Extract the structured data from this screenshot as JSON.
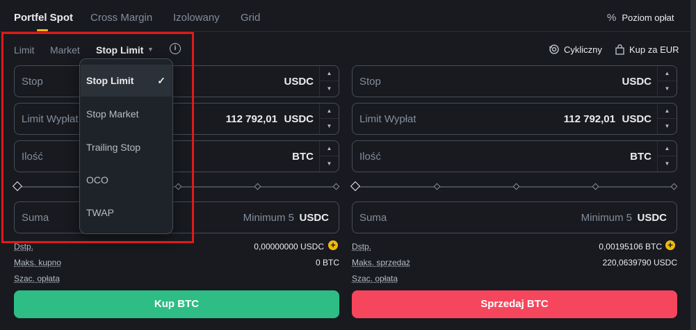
{
  "tabs": [
    {
      "label": "Portfel Spot"
    },
    {
      "label": "Cross Margin"
    },
    {
      "label": "Izolowany"
    },
    {
      "label": "Grid"
    }
  ],
  "fee_link": {
    "label": "Poziom opłat",
    "icon": "percent-icon"
  },
  "order_types": {
    "limit": "Limit",
    "market": "Market",
    "current": "Stop Limit"
  },
  "actions": {
    "recurring": "Cykliczny",
    "buy_eur": "Kup za EUR"
  },
  "buy_form": {
    "stop_label": "Stop",
    "stop_unit": "USDC",
    "limit_label": "Limit Wypłat",
    "limit_value": "112 792,01",
    "limit_unit": "USDC",
    "amount_label": "Ilość",
    "amount_unit": "BTC",
    "total_label": "Suma",
    "total_placeholder": "Minimum 5",
    "total_unit": "USDC",
    "avail_label": "Dstp.",
    "avail_value": "0,00000000 USDC",
    "max_label": "Maks. kupno",
    "max_value": "0 BTC",
    "fee_label": "Szac. opłata",
    "button": "Kup BTC"
  },
  "sell_form": {
    "stop_label": "Stop",
    "stop_unit": "USDC",
    "limit_label": "Limit Wypłat",
    "limit_value": "112 792,01",
    "limit_unit": "USDC",
    "amount_label": "Ilość",
    "amount_unit": "BTC",
    "total_label": "Suma",
    "total_placeholder": "Minimum 5",
    "total_unit": "USDC",
    "avail_label": "Dstp.",
    "avail_value": "0,00195106 BTC",
    "max_label": "Maks. sprzedaż",
    "max_value": "220,0639790 USDC",
    "fee_label": "Szac. opłata",
    "button": "Sprzedaj BTC"
  },
  "dropdown": {
    "items": [
      "Stop Limit",
      "Stop Market",
      "Trailing Stop",
      "OCO",
      "TWAP"
    ],
    "selected": "Stop Limit"
  },
  "colors": {
    "accent": "#f0b90b",
    "buy": "#2ebd85",
    "sell": "#f6465d",
    "highlight": "#e01a1a"
  }
}
